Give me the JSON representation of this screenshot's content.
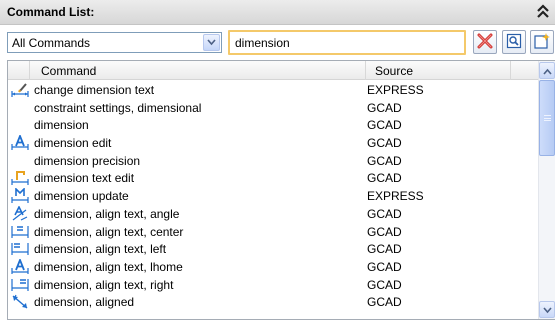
{
  "panel": {
    "title": "Command List:",
    "icon": "double-chevron-up-icon"
  },
  "toolbar": {
    "filter_value": "All Commands",
    "search_value": "dimension",
    "buttons": [
      {
        "name": "clear-search-button",
        "icon": "red-x-icon"
      },
      {
        "name": "find-button",
        "icon": "magnifier-icon"
      },
      {
        "name": "new-command-button",
        "icon": "new-document-icon"
      }
    ]
  },
  "table": {
    "columns": [
      "Command",
      "Source"
    ],
    "rows": [
      {
        "command": "change dimension text",
        "source": "EXPRESS",
        "icon": "dimension-edit-text-icon"
      },
      {
        "command": "constraint settings, dimensional",
        "source": "GCAD",
        "icon": ""
      },
      {
        "command": "dimension",
        "source": "GCAD",
        "icon": ""
      },
      {
        "command": "dimension edit",
        "source": "GCAD",
        "icon": "dimension-edit-icon"
      },
      {
        "command": "dimension precision",
        "source": "GCAD",
        "icon": ""
      },
      {
        "command": "dimension text edit",
        "source": "GCAD",
        "icon": "dimension-text-edit-icon"
      },
      {
        "command": "dimension update",
        "source": "EXPRESS",
        "icon": "dimension-update-icon"
      },
      {
        "command": "dimension, align text, angle",
        "source": "GCAD",
        "icon": "dim-text-angle-icon"
      },
      {
        "command": "dimension, align text, center",
        "source": "GCAD",
        "icon": "dim-text-center-icon"
      },
      {
        "command": "dimension, align text, left",
        "source": "GCAD",
        "icon": "dim-text-left-icon"
      },
      {
        "command": "dimension, align text, lhome",
        "source": "GCAD",
        "icon": "dim-text-home-icon"
      },
      {
        "command": "dimension, align text, right",
        "source": "GCAD",
        "icon": "dim-text-right-icon"
      },
      {
        "command": "dimension, aligned",
        "source": "GCAD",
        "icon": "dimension-aligned-icon"
      }
    ]
  },
  "colors": {
    "search_border": "#f4c96a",
    "icon_blue": "#1f6fd0",
    "clear_red": "#d0312d"
  }
}
